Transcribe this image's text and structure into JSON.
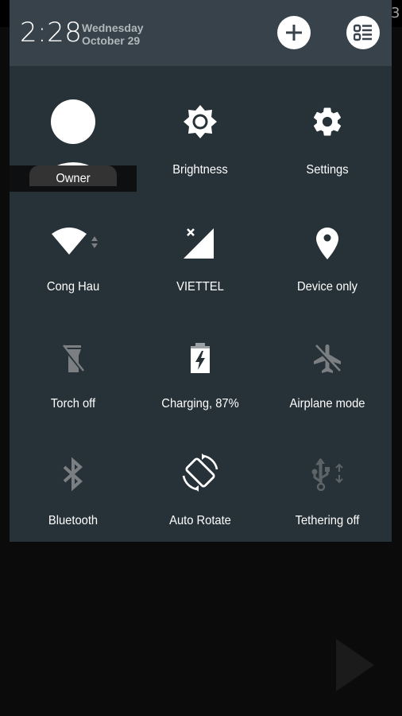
{
  "status_bar": {
    "partial_text": "3"
  },
  "header": {
    "time": "2:28",
    "day": "Wednesday",
    "date": "October 29",
    "add_button_icon": "plus-icon",
    "settings_list_button_icon": "list-settings-icon"
  },
  "tiles": [
    {
      "label": "Owner",
      "icon": "user-avatar-icon",
      "state": "active"
    },
    {
      "label": "Brightness",
      "icon": "brightness-icon",
      "state": "active"
    },
    {
      "label": "Settings",
      "icon": "gear-icon",
      "state": "active"
    },
    {
      "label": "Cong Hau",
      "icon": "wifi-icon",
      "state": "active"
    },
    {
      "label": "VIETTEL",
      "icon": "cell-signal-icon",
      "state": "active"
    },
    {
      "label": "Device only",
      "icon": "location-pin-icon",
      "state": "active"
    },
    {
      "label": "Torch off",
      "icon": "flashlight-off-icon",
      "state": "inactive"
    },
    {
      "label": "Charging, 87%",
      "icon": "battery-charging-icon",
      "state": "active"
    },
    {
      "label": "Airplane mode",
      "icon": "airplane-off-icon",
      "state": "inactive"
    },
    {
      "label": "Bluetooth",
      "icon": "bluetooth-icon",
      "state": "inactive"
    },
    {
      "label": "Auto Rotate",
      "icon": "rotate-icon",
      "state": "active"
    },
    {
      "label": "Tethering off",
      "icon": "usb-tether-icon",
      "state": "inactive"
    }
  ],
  "battery_percent": 87,
  "background": {
    "play_icon": "play-icon"
  },
  "colors": {
    "panel": "#263238",
    "header": "#37424a",
    "active_icon": "#ffffff",
    "inactive_icon": "#7b7f81"
  }
}
